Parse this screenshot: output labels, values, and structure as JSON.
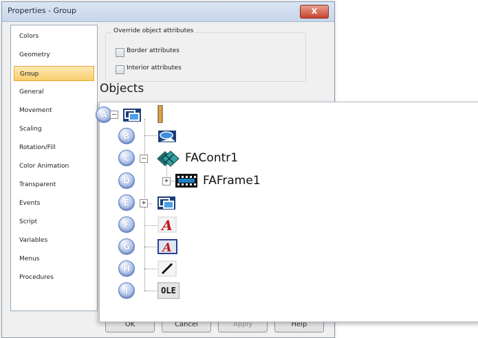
{
  "window": {
    "title": "Properties - Group",
    "close_glyph": "X"
  },
  "sidebar": {
    "items": [
      {
        "label": "Colors"
      },
      {
        "label": "Geometry"
      },
      {
        "label": "Group"
      },
      {
        "label": "General"
      },
      {
        "label": "Movement"
      },
      {
        "label": "Scaling"
      },
      {
        "label": "Rotation/Fill"
      },
      {
        "label": "Color Animation"
      },
      {
        "label": "Transparent"
      },
      {
        "label": "Events"
      },
      {
        "label": "Script"
      },
      {
        "label": "Variables"
      },
      {
        "label": "Menus"
      },
      {
        "label": "Procedures"
      }
    ],
    "selected": "Group"
  },
  "override": {
    "legend": "Override object attributes",
    "border_label": "Border attributes",
    "interior_label": "Interior attributes"
  },
  "objects": {
    "label": "Objects",
    "nodes": [
      {
        "badge": "A",
        "expander": "–",
        "icon": "group-icon",
        "label": ""
      },
      {
        "badge": "B",
        "expander": "",
        "icon": "symbol-icon",
        "label": ""
      },
      {
        "badge": "C",
        "expander": "–",
        "icon": "activex-control-icon",
        "label": "FAContr1"
      },
      {
        "badge": "D",
        "expander": "+",
        "icon": "frame-icon",
        "label": "FAFrame1"
      },
      {
        "badge": "E",
        "expander": "+",
        "icon": "group-icon",
        "label": ""
      },
      {
        "badge": "F",
        "expander": "",
        "icon": "text-icon",
        "label": ""
      },
      {
        "badge": "G",
        "expander": "",
        "icon": "text-box-icon",
        "label": ""
      },
      {
        "badge": "H",
        "expander": "",
        "icon": "line-icon",
        "label": ""
      },
      {
        "badge": "I",
        "expander": "",
        "icon": "ole-icon",
        "label": "OLE"
      }
    ]
  },
  "buttons": {
    "ok": "OK",
    "cancel": "Cancel",
    "apply": "Apply",
    "help": "Help"
  }
}
